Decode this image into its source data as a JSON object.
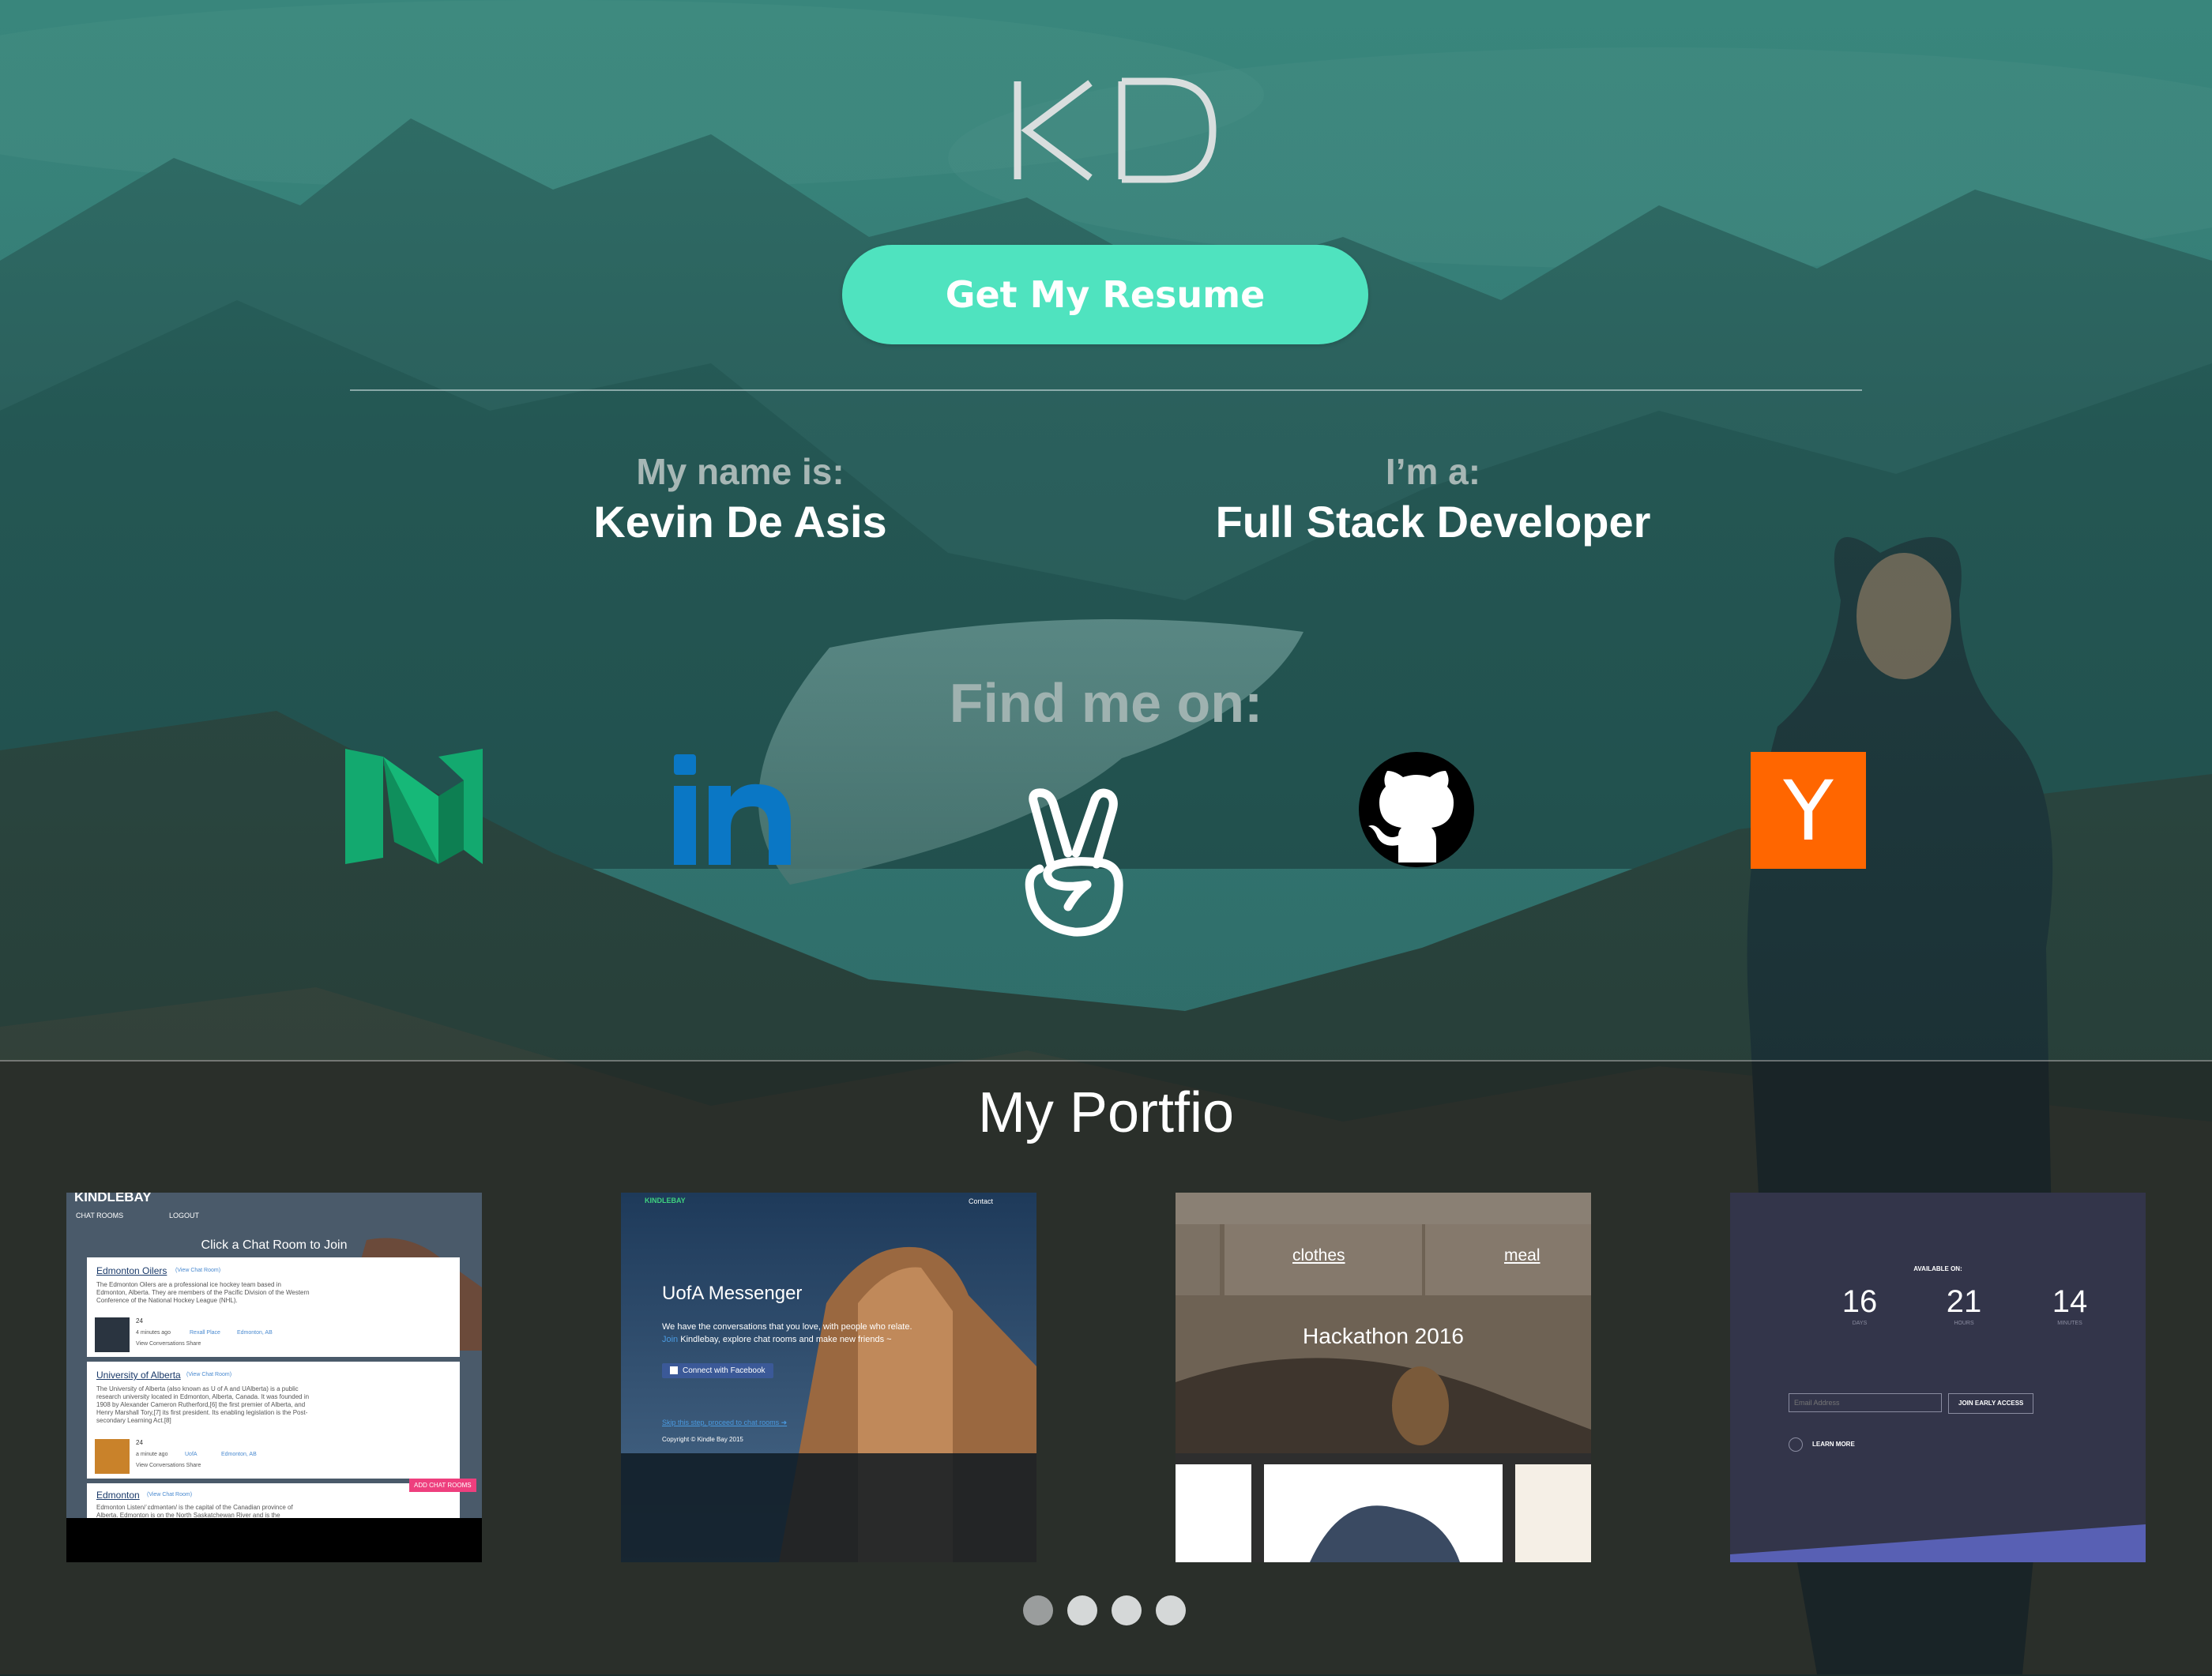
{
  "header": {
    "logo_text": "KD",
    "resume_button": "Get My Resume"
  },
  "info": {
    "name_label": "My name is:",
    "name_value": "Kevin De Asis",
    "role_label": "I’m a:",
    "role_value": "Full Stack Developer"
  },
  "social": {
    "heading": "Find me on:",
    "links": [
      {
        "name": "medium",
        "icon": "medium-icon",
        "color": "#13a96f"
      },
      {
        "name": "linkedin",
        "icon": "linkedin-icon",
        "color": "#0a77c5"
      },
      {
        "name": "angellist",
        "icon": "angellist-icon",
        "color": "#ffffff"
      },
      {
        "name": "github",
        "icon": "github-icon",
        "color": "#000000"
      },
      {
        "name": "hacker-news",
        "icon": "hacker-news-icon",
        "color": "#ff6600",
        "glyph": "Y"
      }
    ]
  },
  "portfolio": {
    "title": "My Portfio",
    "cards": [
      {
        "brand": "KINDLEBAY",
        "nav": [
          "CHAT ROOMS",
          "LOGOUT"
        ],
        "heading": "Click a Chat Room to Join",
        "rooms": [
          {
            "title": "Edmonton Oilers",
            "link": "(View Chat Room)",
            "desc": "The Edmonton Oilers are a professional ice hockey team based in Edmonton, Alberta. They are members of the Pacific Division of the Western Conference of the National Hockey League (NHL).",
            "count": "24",
            "meta": "4 minutes ago",
            "place": "Rexall Place",
            "city": "Edmonton, AB",
            "actions": "View Conversations   Share"
          },
          {
            "title": "University of Alberta",
            "link": "(View Chat Room)",
            "desc": "The University of Alberta (also known as U of A and UAlberta) is a public research university located in Edmonton, Alberta, Canada. It was founded in 1908 by Alexander Cameron Rutherford,[6] the first premier of Alberta, and Henry Marshall Tory,[7] its first president. Its enabling legislation is the Post-secondary Learning Act.[8]",
            "count": "24",
            "meta": "a minute ago",
            "place": "UofA",
            "city": "Edmonton, AB",
            "actions": "View Conversations   Share"
          },
          {
            "title": "Edmonton",
            "link": "(View Chat Room)",
            "desc": "Edmonton Listen/ˈɛdməntən/ is the capital of the Canadian province of Alberta. Edmonton is on the North Saskatchewan River and is the"
          }
        ],
        "add_button": "ADD CHAT ROOMS"
      },
      {
        "brand": "KINDLEBAY",
        "nav_right": "Contact",
        "title": "UofA Messenger",
        "line1": "We have the conversations that you love, with people who relate.",
        "line2_link": "Join",
        "line2": " Kindlebay, explore chat rooms and make new friends ~",
        "fb_button": "Connect with Facebook",
        "skip": "Skip this step, proceed to chat rooms ➜",
        "copyright": "Copyright © Kindle Bay 2015"
      },
      {
        "tabs": [
          "clothes",
          "meal"
        ],
        "title": "Hackathon 2016"
      },
      {
        "available": "AVAILABLE ON:",
        "countdown": [
          {
            "value": "16",
            "unit": "DAYS"
          },
          {
            "value": "21",
            "unit": "HOURS"
          },
          {
            "value": "14",
            "unit": "MINUTES"
          }
        ],
        "email_placeholder": "Email Address",
        "join_button": "JOIN EARLY ACCESS",
        "learn_more": "LEARN MORE"
      }
    ],
    "slides": 4,
    "active_slide": 0
  },
  "colors": {
    "accent": "#4fe3bf",
    "hn_orange": "#ff6600",
    "medium_green": "#13a96f",
    "linkedin_blue": "#0a77c5"
  }
}
